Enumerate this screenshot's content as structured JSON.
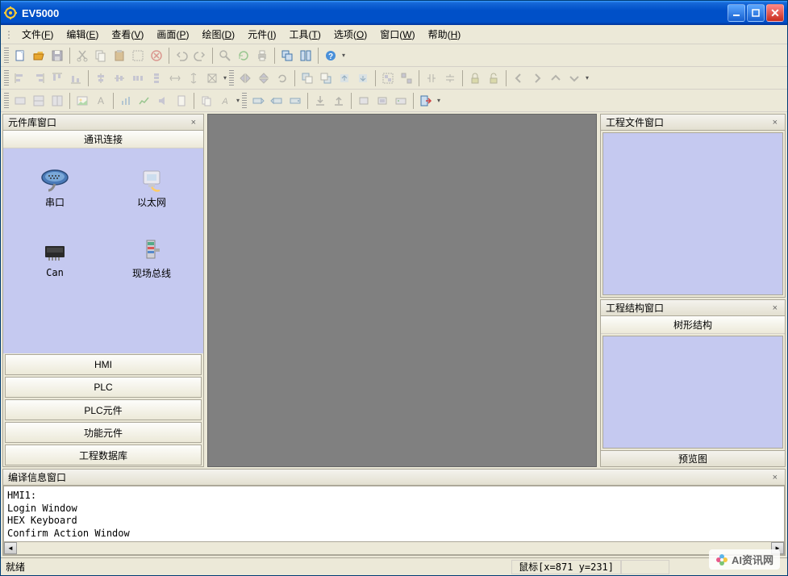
{
  "app": {
    "title": "EV5000"
  },
  "menu": [
    {
      "label": "文件",
      "key": "F"
    },
    {
      "label": "编辑",
      "key": "E"
    },
    {
      "label": "查看",
      "key": "V"
    },
    {
      "label": "画面",
      "key": "P"
    },
    {
      "label": "绘图",
      "key": "D"
    },
    {
      "label": "元件",
      "key": "I"
    },
    {
      "label": "工具",
      "key": "T"
    },
    {
      "label": "选项",
      "key": "O"
    },
    {
      "label": "窗口",
      "key": "W"
    },
    {
      "label": "帮助",
      "key": "H"
    }
  ],
  "left_panel": {
    "title": "元件库窗口",
    "subheader": "通讯连接",
    "connections": [
      {
        "label": "串口",
        "icon": "serial-port"
      },
      {
        "label": "以太网",
        "icon": "ethernet"
      },
      {
        "label": "Can",
        "icon": "can-bus"
      },
      {
        "label": "现场总线",
        "icon": "fieldbus"
      }
    ],
    "categories": [
      "HMI",
      "PLC",
      "PLC元件",
      "功能元件",
      "工程数据库"
    ]
  },
  "right": {
    "project_files_title": "工程文件窗口",
    "project_struct_title": "工程结构窗口",
    "tree_header": "树形结构",
    "preview_label": "预览图"
  },
  "compile": {
    "title": "编译信息窗口",
    "lines": [
      "HMI1:",
      "Login Window",
      "HEX Keyboard",
      "Confirm Action Window"
    ]
  },
  "status": {
    "ready": "就绪",
    "mouse": "鼠标[x=871  y=231]"
  },
  "watermark": "AI资讯网"
}
